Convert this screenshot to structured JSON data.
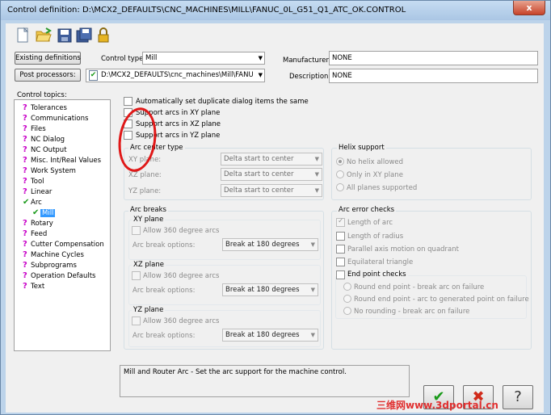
{
  "window": {
    "title": "Control definition: D:\\MCX2_DEFAULTS\\CNC_MACHINES\\MILL\\FANUC_0L_G51_Q1_ATC_OK.CONTROL",
    "close_glyph": "x"
  },
  "toolbar": {
    "icons": [
      "new-file-icon",
      "open-folder-icon",
      "save-icon",
      "save-as-icon",
      "lock-icon"
    ]
  },
  "header": {
    "existing_definitions_label": "Existing definitions",
    "control_type_label": "Control type:",
    "control_type_value": "Mill",
    "manufacturer_label": "Manufacturer:",
    "manufacturer_value": "NONE",
    "post_processors_label": "Post processors:",
    "post_path": "D:\\MCX2_DEFAULTS\\cnc_machines\\Mill\\FANU",
    "description_label": "Description:",
    "description_value": "NONE"
  },
  "sidebar": {
    "title": "Control topics:",
    "items": [
      {
        "label": "Tolerances"
      },
      {
        "label": "Communications"
      },
      {
        "label": "Files"
      },
      {
        "label": "NC Dialog"
      },
      {
        "label": "NC Output"
      },
      {
        "label": "Misc. Int/Real Values"
      },
      {
        "label": "Work System"
      },
      {
        "label": "Tool"
      },
      {
        "label": "Linear"
      },
      {
        "label": "Arc"
      },
      {
        "label": "Mill"
      },
      {
        "label": "Rotary"
      },
      {
        "label": "Feed"
      },
      {
        "label": "Cutter Compensation"
      },
      {
        "label": "Machine Cycles"
      },
      {
        "label": "Subprograms"
      },
      {
        "label": "Operation Defaults"
      },
      {
        "label": "Text"
      }
    ]
  },
  "options": {
    "dup_items": "Automatically set duplicate dialog items the same",
    "arcs_xy": "Support arcs in XY plane",
    "arcs_xz": "Support arcs in XZ plane",
    "arcs_yz": "Support arcs in YZ plane"
  },
  "arc_center": {
    "title": "Arc center type",
    "xy_label": "XY plane:",
    "xz_label": "XZ plane:",
    "yz_label": "YZ plane:",
    "xy_value": "Delta start to center",
    "xz_value": "Delta start to center",
    "yz_value": "Delta start to center"
  },
  "helix": {
    "title": "Helix support",
    "no_helix": "No helix allowed",
    "only_xy": "Only in XY plane",
    "all_planes": "All planes supported"
  },
  "arc_breaks": {
    "title": "Arc breaks",
    "xy_title": "XY plane",
    "xz_title": "XZ plane",
    "yz_title": "YZ plane",
    "allow_360": "Allow 360 degree arcs",
    "break_options_label": "Arc break options:",
    "break_value": "Break at 180 degrees"
  },
  "arc_error": {
    "title": "Arc error checks",
    "length_of_arc": "Length of arc",
    "length_of_radius": "Length of radius",
    "parallel_axis": "Parallel axis motion on quadrant",
    "equilateral": "Equilateral triangle",
    "end_point_title": "End point checks",
    "round_break": "Round end point - break arc on failure",
    "round_arc_to_point": "Round end point - arc to generated point on failure",
    "no_rounding": "No rounding - break arc on failure"
  },
  "description_box": "Mill and Router Arc - Set the arc support for the machine control.",
  "buttons": {
    "ok": "✔",
    "cancel": "✖",
    "help": "?"
  },
  "watermark": "三维网www.3dportal.cn",
  "colors": {
    "title_bar": "#aac6e4",
    "topic_icon": "#c800c8",
    "check_green": "#1a9a1a",
    "annotation_red": "#e01818"
  }
}
